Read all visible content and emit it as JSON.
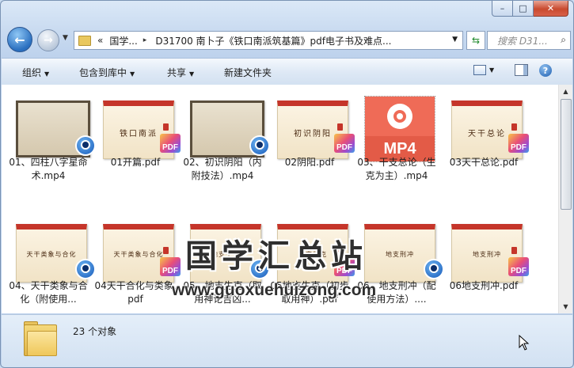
{
  "window": {
    "caption_buttons": {
      "minimize": "–",
      "maximize": "□",
      "close": "✕"
    }
  },
  "nav": {
    "back_icon": "back-arrow-icon",
    "forward_icon": "forward-arrow-icon",
    "address": {
      "prefix": "«",
      "crumb1": "国学...",
      "separator": "▸",
      "crumb2": "D31700 南卜子《铁口南派筑基篇》pdf电子书及难点..."
    },
    "search_placeholder": "搜索 D31..."
  },
  "toolbar": {
    "organize": "组织",
    "include_in_library": "包含到库中",
    "share": "共享",
    "new_folder": "新建文件夹"
  },
  "files": [
    {
      "name": "01、四柱八字星命术.mp4",
      "type": "mp4",
      "thumb_title": ""
    },
    {
      "name": "01开篇.pdf",
      "type": "pdf",
      "thumb_title": "铁口南派"
    },
    {
      "name": "02、初识阴阳（内附技法）.mp4",
      "type": "mp4",
      "thumb_title": ""
    },
    {
      "name": "02阴阳.pdf",
      "type": "pdf",
      "thumb_title": "初识阴阳"
    },
    {
      "name": "03、干支总论（生克为主）.mp4",
      "type": "mp4-big",
      "thumb_title": "MP4"
    },
    {
      "name": "03天干总论.pdf",
      "type": "pdf",
      "thumb_title": "天干总论"
    },
    {
      "name": "04、天干类象与合化（附使用...",
      "type": "mp4",
      "thumb_title": "天干类象与合化"
    },
    {
      "name": "04天干合化与类象.pdf",
      "type": "pdf",
      "thumb_title": "天干类象与合化"
    },
    {
      "name": "05、地支生克（取用神论吉凶...",
      "type": "mp4",
      "thumb_title": "地支生克"
    },
    {
      "name": "05地支生克（初步取用神）.pdf",
      "type": "pdf",
      "thumb_title": "地支生克"
    },
    {
      "name": "06、地支刑冲（配使用方法）....",
      "type": "mp4",
      "thumb_title": "地支刑冲"
    },
    {
      "name": "06地支刑冲.pdf",
      "type": "pdf",
      "thumb_title": "地支刑冲"
    }
  ],
  "watermark": {
    "title": "国学汇总站",
    "url": "www.guoxuehuizong.com"
  },
  "status": {
    "count_text": "23 个对象"
  }
}
